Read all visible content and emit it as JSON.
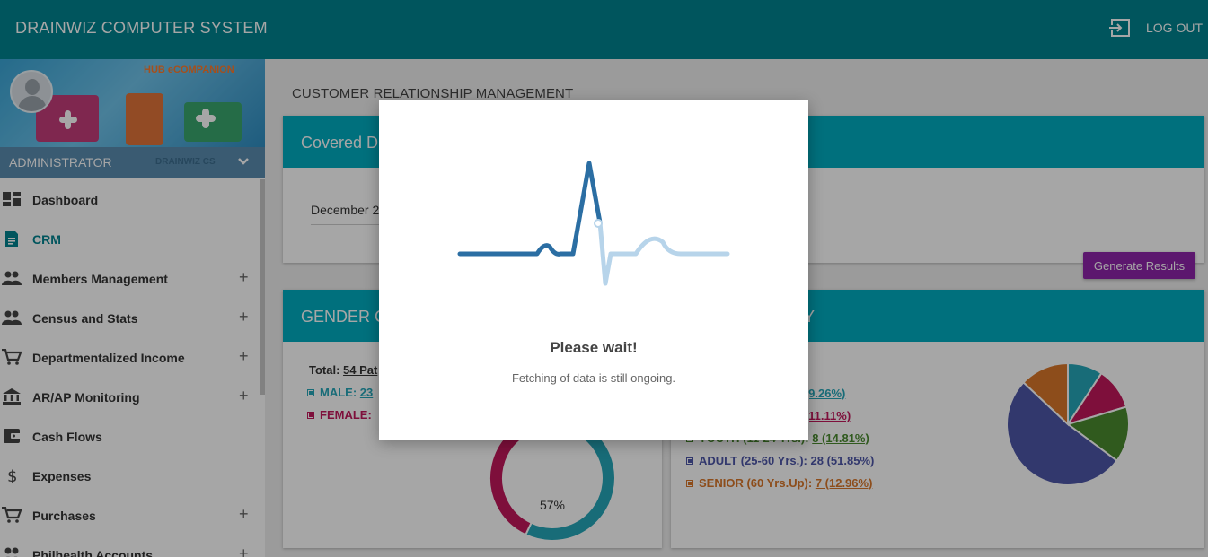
{
  "header": {
    "title": "DRAINWIZ COMPUTER SYSTEM",
    "logout_label": "LOG OUT"
  },
  "sidebar": {
    "banner_label": "HUB eCOMPANION",
    "user_role": "ADMINISTRATOR",
    "user_company": "DRAINWIZ CS",
    "items": [
      {
        "label": "Dashboard",
        "icon": "dashboard-icon",
        "expandable": false,
        "active": false
      },
      {
        "label": "CRM",
        "icon": "document-icon",
        "expandable": false,
        "active": true
      },
      {
        "label": "Members Management",
        "icon": "people-icon",
        "expandable": true
      },
      {
        "label": "Census and Stats",
        "icon": "people-icon",
        "expandable": true
      },
      {
        "label": "Departmentalized Income",
        "icon": "cart-icon",
        "expandable": true
      },
      {
        "label": "AR/AP Monitoring",
        "icon": "bank-icon",
        "expandable": true
      },
      {
        "label": "Cash Flows",
        "icon": "wallet-icon",
        "expandable": false
      },
      {
        "label": "Expenses",
        "icon": "dollar-icon",
        "expandable": false
      },
      {
        "label": "Purchases",
        "icon": "cart-icon",
        "expandable": true
      },
      {
        "label": "Philhealth Accounts",
        "icon": "people-icon",
        "expandable": true
      }
    ],
    "plus_symbol": "+"
  },
  "main": {
    "breadcrumb": "CUSTOMER RELATIONSHIP MANAGEMENT",
    "covered": {
      "title": "Covered D",
      "date_value": "December 2",
      "button_label": "Generate Results"
    },
    "gender": {
      "title": "GENDER C",
      "total_label": "Total:",
      "total_value": "54 Pat",
      "male_label": "MALE:",
      "male_value": "23",
      "female_label": "FEMALE:",
      "donut_label": "57%"
    },
    "age": {
      "title": "Y",
      "rows": [
        {
          "label": "",
          "value": "5 (9.26%)",
          "color": "#26a6b8"
        },
        {
          "label": "",
          "value": "6 (11.11%)",
          "color": "#c2185b"
        },
        {
          "label": "YOUTH (11-24 Yrs.):",
          "value": "8 (14.81%)",
          "color": "#4a8a2f"
        },
        {
          "label": "ADULT (25-60 Yrs.):",
          "value": "28 (51.85%)",
          "color": "#4e56a8"
        },
        {
          "label": "SENIOR (60 Yrs.Up):",
          "value": "7 (12.96%)",
          "color": "#d9772a"
        }
      ]
    }
  },
  "chart_data": [
    {
      "type": "pie",
      "categories": [
        "",
        "",
        "YOUTH (11-24 Yrs.)",
        "ADULT (25-60 Yrs.)",
        "SENIOR (60 Yrs.Up)"
      ],
      "values": [
        5,
        6,
        8,
        28,
        7
      ]
    },
    {
      "type": "pie",
      "categories": [
        "MALE",
        "FEMALE"
      ],
      "values": [
        57,
        43
      ]
    }
  ],
  "modal": {
    "title": "Please wait!",
    "text": "Fetching of data is still ongoing."
  }
}
